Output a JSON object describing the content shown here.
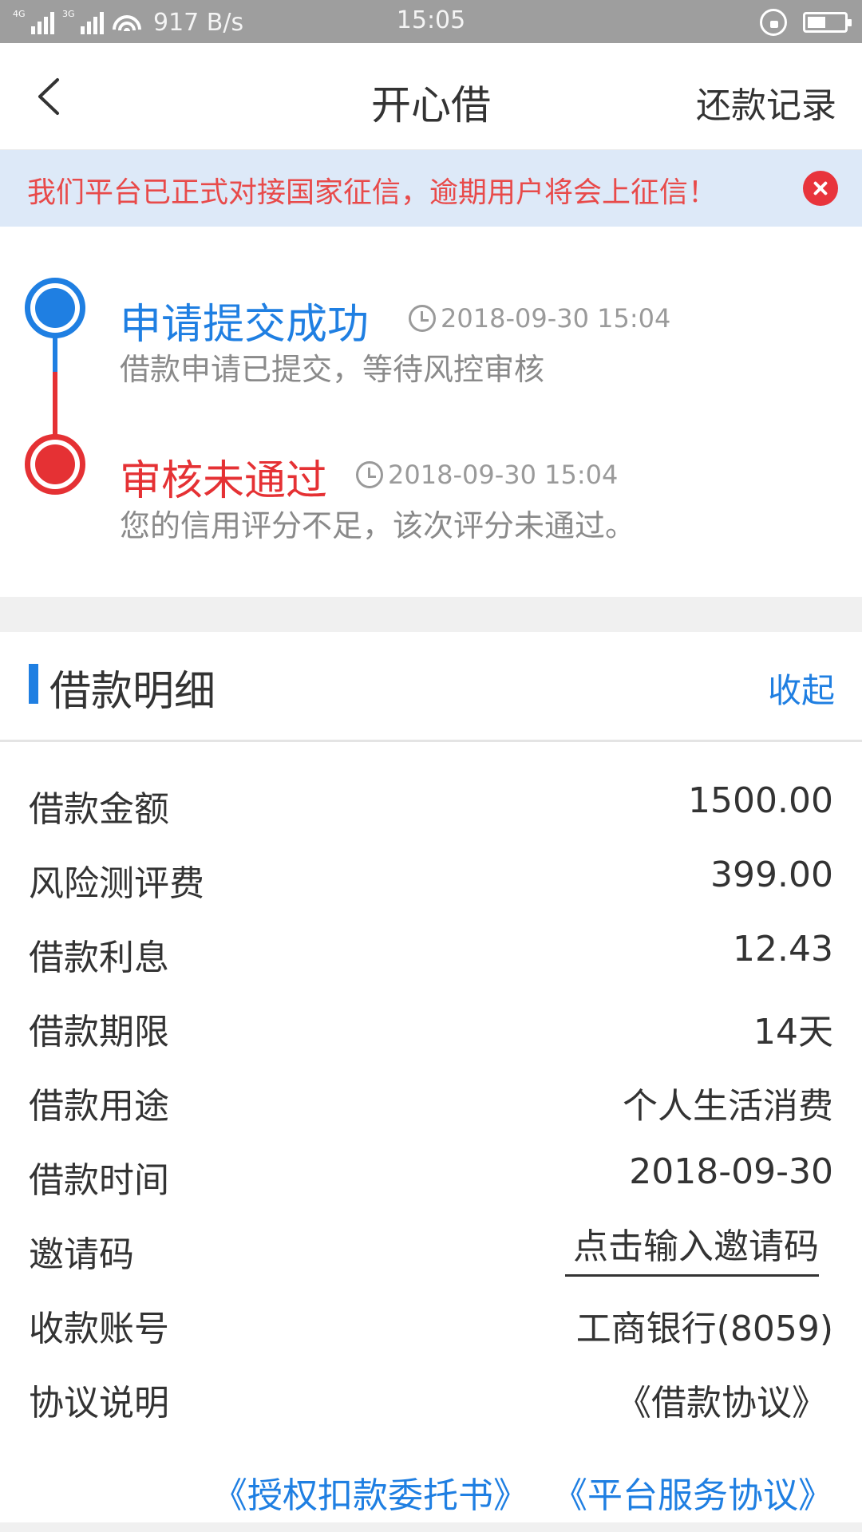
{
  "status_bar": {
    "network_tag_1": "4G",
    "network_tag_2": "3G",
    "speed": "917 B/s",
    "time": "15:05"
  },
  "nav": {
    "title": "开心借",
    "right_action": "还款记录"
  },
  "notice": {
    "text": "我们平台已正式对接国家征信，逾期用户将会上征信！"
  },
  "timeline": {
    "steps": [
      {
        "title": "申请提交成功",
        "time": "2018-09-30 15:04",
        "desc": "借款申请已提交，等待风控审核"
      },
      {
        "title": "审核未通过",
        "time": "2018-09-30 15:04",
        "desc": "您的信用评分不足，该次评分未通过。"
      }
    ]
  },
  "details": {
    "section_title": "借款明细",
    "collapse_label": "收起",
    "rows": [
      {
        "label": "借款金额",
        "value": "1500.00"
      },
      {
        "label": "风险测评费",
        "value": "399.00"
      },
      {
        "label": "借款利息",
        "value": "12.43"
      },
      {
        "label": "借款期限",
        "value": "14天"
      },
      {
        "label": "借款用途",
        "value": "个人生活消费"
      },
      {
        "label": "借款时间",
        "value": "2018-09-30"
      }
    ],
    "invite": {
      "label": "邀请码",
      "placeholder": "点击输入邀请码"
    },
    "account": {
      "label": "收款账号",
      "value": "工商银行(8059)"
    },
    "agreements": {
      "label": "协议说明",
      "loan_agreement": "《借款协议》",
      "authorization": "《授权扣款委托书》",
      "service": "《平台服务协议》"
    }
  },
  "colors": {
    "accent_blue": "#1f7fe2",
    "alert_red": "#e53134",
    "notice_bg": "#dde9f8",
    "status_bar_bg": "#9e9e9e"
  }
}
